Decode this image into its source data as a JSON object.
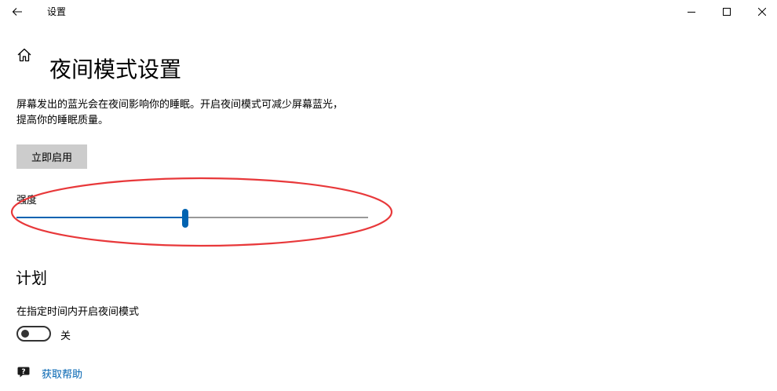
{
  "window": {
    "title": "设置"
  },
  "header": {
    "title": "夜间模式设置"
  },
  "description": {
    "line1": "屏幕发出的蓝光会在夜间影响你的睡眠。开启夜间模式可减少屏幕蓝光，",
    "line2": "提高你的睡眠质量。"
  },
  "enable_button": {
    "label": "立即启用"
  },
  "strength": {
    "label": "强度",
    "value_fraction": 0.48
  },
  "schedule": {
    "heading": "计划",
    "toggle_label": "在指定时间内开启夜间模式",
    "toggle_state": "关",
    "toggle_on": false
  },
  "help": {
    "link_label": "获取帮助"
  },
  "colors": {
    "accent": "#0063b1",
    "annotation": "#e8383a",
    "button_bg": "#cccccc",
    "track_rest": "#999999"
  },
  "icons": {
    "back": "back-arrow-icon",
    "home": "home-icon",
    "minimize": "minimize-icon",
    "maximize": "maximize-icon",
    "close": "close-icon",
    "help": "help-chat-icon"
  }
}
